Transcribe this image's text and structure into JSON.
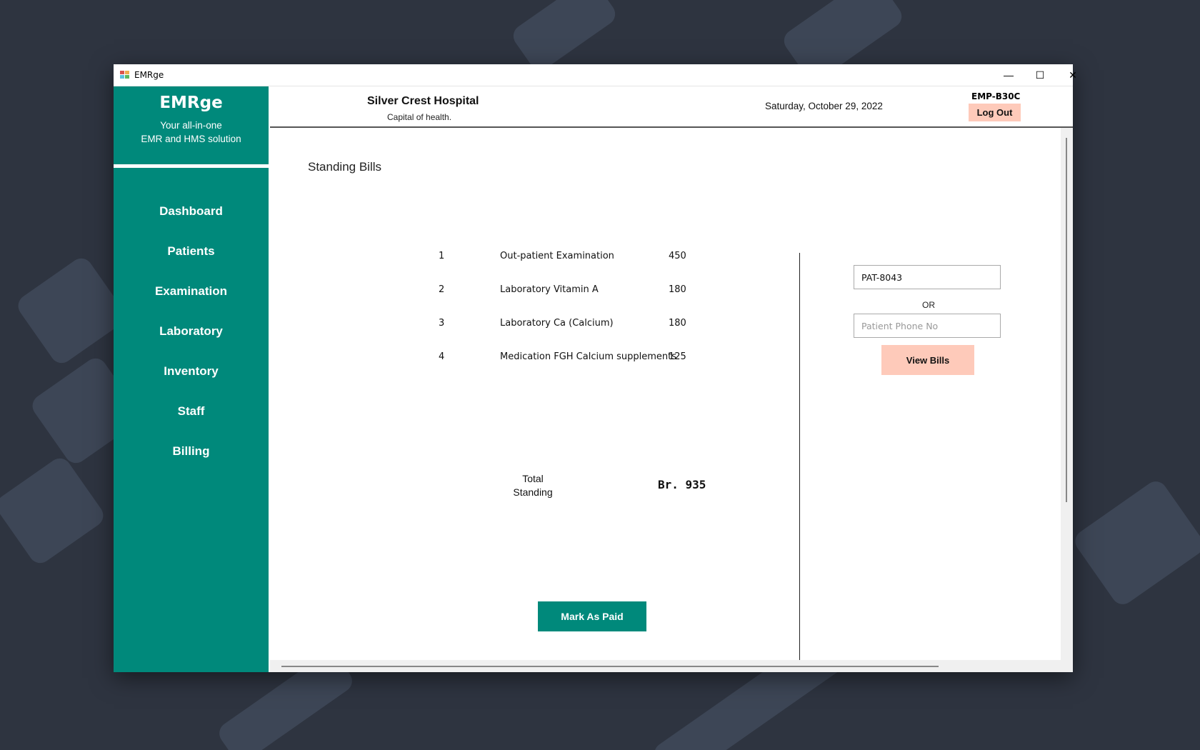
{
  "window": {
    "title": "EMRge",
    "controls": {
      "minimize": "—",
      "maximize": "☐",
      "close": "✕"
    }
  },
  "sidebar": {
    "brand": "EMRge",
    "tagline_line1": "Your all-in-one",
    "tagline_line2": "EMR and HMS solution",
    "items": [
      {
        "label": "Dashboard"
      },
      {
        "label": "Patients"
      },
      {
        "label": "Examination"
      },
      {
        "label": "Laboratory"
      },
      {
        "label": "Inventory"
      },
      {
        "label": "Staff"
      },
      {
        "label": "Billing"
      }
    ]
  },
  "header": {
    "hospital_name": "Silver Crest Hospital",
    "hospital_tagline": "Capital of health.",
    "date": "Saturday, October 29, 2022",
    "employee_id": "EMP-B30C",
    "logout_label": "Log Out"
  },
  "bills": {
    "title": "Standing Bills",
    "rows": [
      {
        "no": "1",
        "description": "Out-patient Examination",
        "amount": "450"
      },
      {
        "no": "2",
        "description": "Laboratory Vitamin A",
        "amount": "180"
      },
      {
        "no": "3",
        "description": "Laboratory Ca (Calcium)",
        "amount": "180"
      },
      {
        "no": "4",
        "description": "Medication FGH Calcium supplements",
        "amount": "125"
      }
    ],
    "total_label_line1": "Total",
    "total_label_line2": "Standing",
    "total_value": "Br. 935",
    "mark_paid_label": "Mark As Paid"
  },
  "search": {
    "patient_id_value": "PAT-8043",
    "or_label": "OR",
    "phone_placeholder": "Patient Phone No",
    "view_bills_label": "View Bills"
  },
  "colors": {
    "accent": "#00897b",
    "button_secondary": "#fecaba"
  }
}
